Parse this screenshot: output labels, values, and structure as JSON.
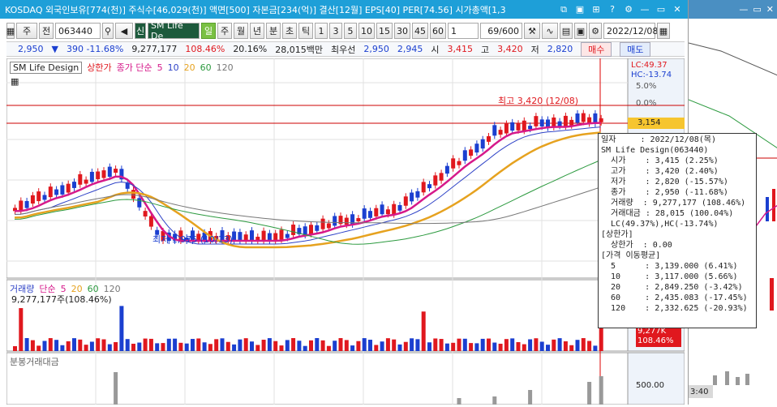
{
  "window": {
    "title": "KOSDAQ 외국인보유[774(천)] 주식수[46,029(천)] 액면[500] 자본금[234(억)] 결산[12월] EPS[40] PER[74.56] 시가총액[1,3"
  },
  "toolbar": {
    "period_unit": "주",
    "market": "전",
    "code": "063440",
    "badge": "신",
    "name": "SM Life De",
    "tabs": [
      "일",
      "주",
      "월",
      "년",
      "분",
      "초",
      "틱"
    ],
    "intervals": [
      "1",
      "3",
      "5",
      "10",
      "15",
      "30",
      "45",
      "60"
    ],
    "interval_select": "1",
    "page": "69/600",
    "date": "2022/12/08"
  },
  "quote": {
    "price": "2,950",
    "change_arrow": "▼",
    "change": "390 -11.68%",
    "volume": "9,277,177",
    "vol_ratio": "108.46%",
    "turnover": "20.16%",
    "amount": "28,015백만",
    "pref_label": "최우선",
    "bid": "2,950",
    "ask": "2,945",
    "open_label": "시",
    "open": "3,415",
    "high_label": "고",
    "high": "3,420",
    "low_label": "저",
    "low": "2,820",
    "buy": "매수",
    "sell": "매도"
  },
  "price_panel": {
    "name_tag": "SM Life Design",
    "limit_label": "상한가",
    "ma_label": "종가 단순",
    "ma_periods": [
      "5",
      "10",
      "20",
      "60",
      "120"
    ],
    "ma_colors": [
      "#d6198a",
      "#2f43c7",
      "#e6a21f",
      "#2c9a3f",
      "#777777"
    ],
    "lc": "LC:49.37",
    "hc": "HC:-13.74",
    "pct_5": "5.0%",
    "pct_0": "0.0%",
    "current_price_tag": "3,154",
    "high_note": "최고 3,420 (12/08)",
    "low_note": "최저 1,975 (10/13)"
  },
  "volume_panel": {
    "label": "거래량",
    "ma_label": "단순",
    "ma_periods": [
      "5",
      "20",
      "60",
      "120"
    ],
    "value_note": "9,277,177주(108.46%)",
    "tag_value": "9,277K",
    "tag_pct": "108.46%"
  },
  "amount_panel": {
    "label": "분봉거래대금",
    "axis_value": "500.00"
  },
  "tooltip": {
    "lines": [
      "일자     : 2022/12/08(목)",
      "SM Life Design(063440)",
      "  시가    : 3,415 (2.25%)",
      "  고가    : 3,420 (2.40%)",
      "  저가    : 2,820 (-15.57%)",
      "  종가    : 2,950 (-11.68%)",
      "  거래량  : 9,277,177 (108.46%)",
      "  거래대금 : 28,015 (100.04%)",
      "  LC(49.37%),HC(-13.74%)",
      "[상한가]",
      "  상한가  : 0.00",
      "[가격 이동평균]",
      "  5      : 3,139.000 (6.41%)",
      "  10     : 3,117.000 (5.66%)",
      "  20     : 2,849.250 (-3.42%)",
      "  60     : 2,435.083 (-17.45%)",
      "  120    : 2,332.625 (-20.93%)"
    ]
  },
  "side_panel": {
    "time_label": "3:40"
  }
}
